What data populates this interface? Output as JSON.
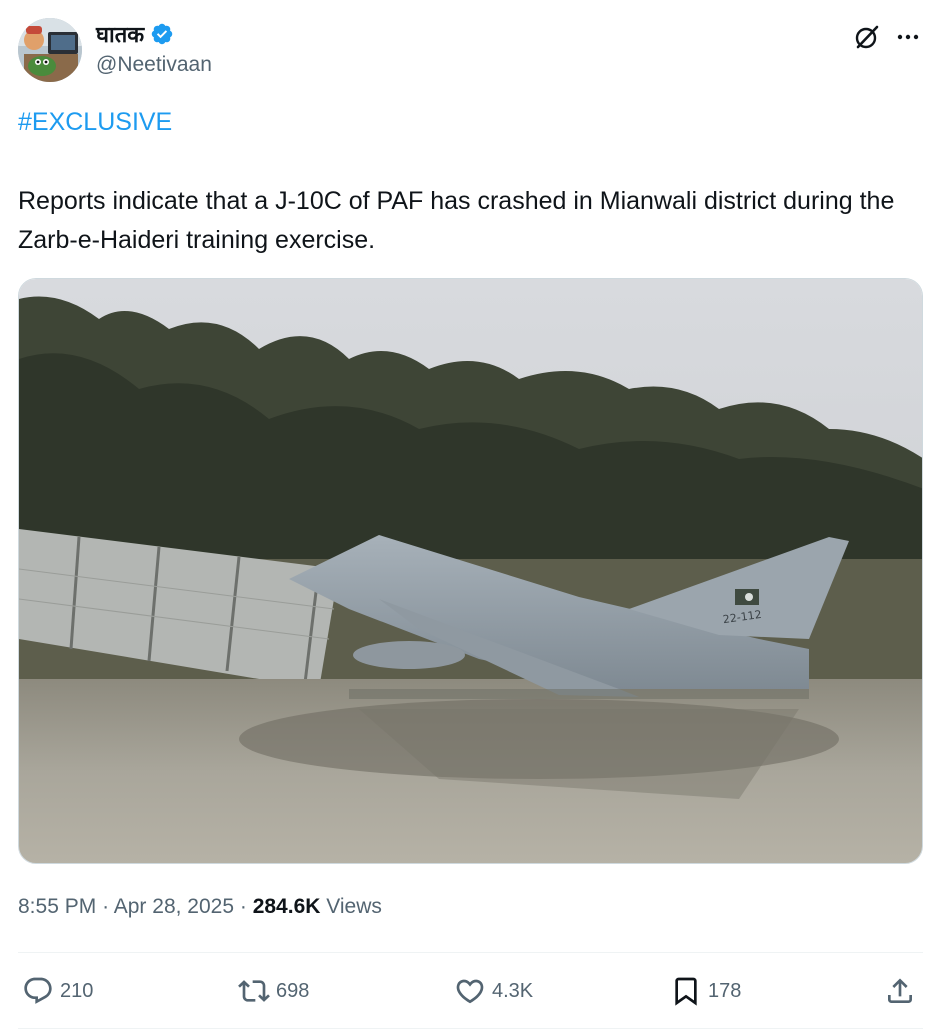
{
  "author": {
    "display_name": "घातक",
    "handle": "@Neetivaan"
  },
  "tweet": {
    "hashtag": "#EXCLUSIVE",
    "text": "Reports indicate that a J-10C of PAF has crashed in Mianwali district during the Zarb-e-Haideri training exercise.",
    "media_aircraft_marking": "22-112"
  },
  "meta": {
    "time": "8:55 PM",
    "separator": "·",
    "date": "Apr 28, 2025",
    "views_count": "284.6K",
    "views_label": "Views"
  },
  "actions": {
    "replies": "210",
    "reposts": "698",
    "likes": "4.3K",
    "bookmarks": "178"
  },
  "colors": {
    "link": "#1d9bf0",
    "secondary_text": "#536471",
    "primary_text": "#0f1419",
    "verified": "#1d9bf0"
  },
  "icons": [
    "verified-badge-icon",
    "grok-icon",
    "more-icon",
    "reply-icon",
    "repost-icon",
    "like-icon",
    "bookmark-icon",
    "share-icon"
  ]
}
